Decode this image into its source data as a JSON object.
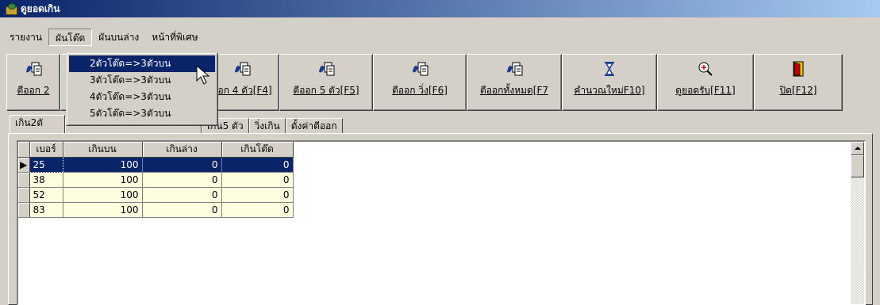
{
  "window": {
    "title": "ดูยอดเกิน"
  },
  "menu": {
    "items": [
      {
        "label": "รายงาน",
        "active": false
      },
      {
        "label": "ผันโต๊ด",
        "active": true
      },
      {
        "label": "ผันบนล่าง",
        "active": false
      },
      {
        "label": "หน้าที่พิเศษ",
        "active": false
      }
    ],
    "dropdown": [
      {
        "label": "2ตัวโต๊ด=>3ตัวบน",
        "highlighted": true
      },
      {
        "label": "3ตัวโต๊ด=>3ตัวบน",
        "highlighted": false
      },
      {
        "label": "4ตัวโต๊ด=>3ตัวบน",
        "highlighted": false
      },
      {
        "label": "5ตัวโต๊ด=>3ตัวบน",
        "highlighted": false
      }
    ]
  },
  "toolbar": {
    "buttons": [
      {
        "label": "ตีออก 2",
        "icon": "copy-docs-icon"
      },
      {
        "label": "",
        "icon": "copy-docs-icon"
      },
      {
        "label": "ออก 4 ตัว[F4]",
        "icon": "copy-docs-icon"
      },
      {
        "label": "ตีออก 5 ตัว[F5]",
        "icon": "copy-docs-icon"
      },
      {
        "label": "ตีออก วิ่ง[F6]",
        "icon": "copy-docs-icon"
      },
      {
        "label": "ตีออกทั้งหมด[F7",
        "icon": "copy-docs-icon"
      },
      {
        "label": "คำนวณใหม่F10]",
        "icon": "hourglass-icon"
      },
      {
        "label": "ดูยอดรับ[F11]",
        "icon": "zoom-in-icon"
      },
      {
        "label": "ปิด[F12]",
        "icon": "exit-door-icon"
      }
    ]
  },
  "tabs": [
    {
      "label": "เกิน2ตั",
      "active": true
    },
    {
      "label": "",
      "active": false
    },
    {
      "label": "เกิน5 ตัว",
      "active": false
    },
    {
      "label": "วิ่งเกิน",
      "active": false
    },
    {
      "label": "ตั้งค่าตีออก",
      "active": false
    }
  ],
  "grid": {
    "columns": [
      "เบอร์",
      "เกินบน",
      "เกินล่าง",
      "เกินโต๊ด"
    ],
    "rows": [
      [
        "25",
        "100",
        "0",
        "0"
      ],
      [
        "38",
        "100",
        "0",
        "0"
      ],
      [
        "52",
        "100",
        "0",
        "0"
      ],
      [
        "83",
        "100",
        "0",
        "0"
      ]
    ],
    "selected_row": 0
  },
  "colors": {
    "title_start": "#0a246a",
    "title_end": "#a6caf0",
    "selection": "#0a246a",
    "cell_bg": "#fffde0",
    "face": "#d4d0c8"
  }
}
